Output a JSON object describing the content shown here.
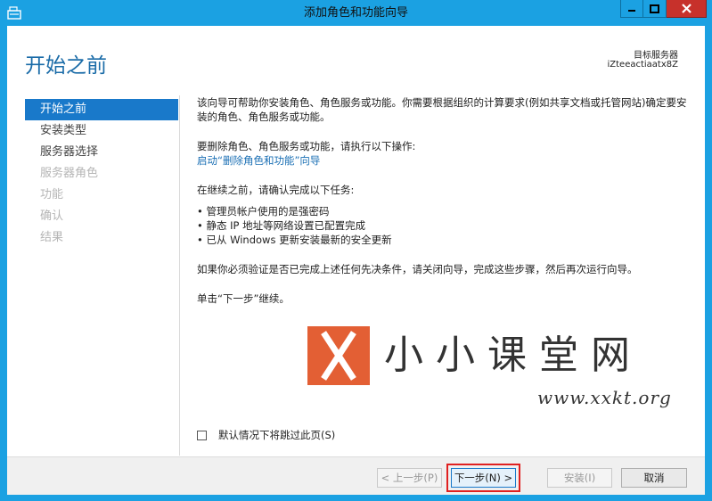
{
  "window": {
    "title": "添加角色和功能向导",
    "accent_color": "#1ba1e2",
    "close_color": "#c7312b",
    "icons": [
      "app-wizard-icon",
      "minimize-icon",
      "maximize-icon",
      "close-icon"
    ]
  },
  "header": {
    "page_title": "开始之前",
    "target_label": "目标服务器",
    "target_value": "iZteeactiaatx8Z"
  },
  "nav": {
    "items": [
      {
        "label": "开始之前",
        "state": "active"
      },
      {
        "label": "安装类型",
        "state": "normal"
      },
      {
        "label": "服务器选择",
        "state": "normal"
      },
      {
        "label": "服务器角色",
        "state": "disabled"
      },
      {
        "label": "功能",
        "state": "disabled"
      },
      {
        "label": "确认",
        "state": "disabled"
      },
      {
        "label": "结果",
        "state": "disabled"
      }
    ],
    "active_color": "#1979ca"
  },
  "content": {
    "intro": "该向导可帮助你安装角色、角色服务或功能。你需要根据组织的计算要求(例如共享文档或托管网站)确定要安装的角色、角色服务或功能。",
    "remove_text": "要删除角色、角色服务或功能，请执行以下操作:",
    "remove_link": "启动“删除角色和功能”向导",
    "before_text": "在继续之前，请确认完成以下任务:",
    "tasks": [
      "管理员帐户使用的是强密码",
      "静态 IP 地址等网络设置已配置完成",
      "已从 Windows 更新安装最新的安全更新"
    ],
    "verify_text": "如果你必须验证是否已完成上述任何先决条件，请关闭向导，完成这些步骤，然后再次运行向导。",
    "continue_text": "单击“下一步”继续。"
  },
  "watermark": {
    "text": "小小课堂网",
    "url": "www.xxkt.org",
    "logo_color": "#e35f34"
  },
  "skip_checkbox": {
    "label": "默认情况下将跳过此页(S)",
    "checked": false
  },
  "footer": {
    "prev_label": "< 上一步(P)",
    "next_label": "下一步(N) >",
    "install_label": "安装(I)",
    "cancel_label": "取消",
    "highlight_color": "#e02020"
  }
}
